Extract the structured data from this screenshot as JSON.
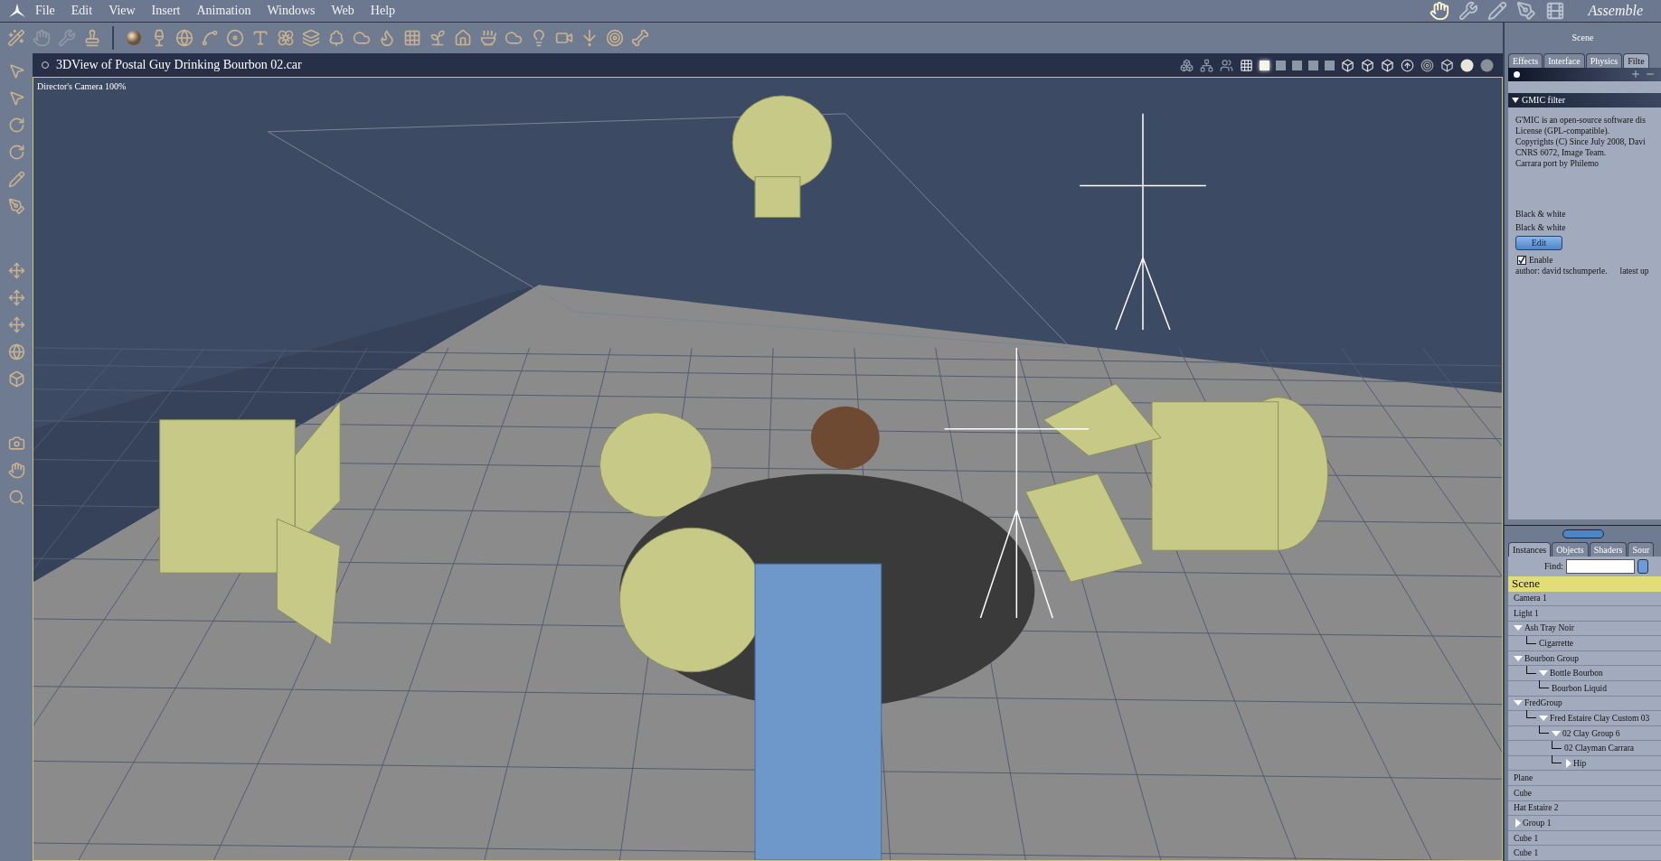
{
  "menu": [
    "File",
    "Edit",
    "View",
    "Insert",
    "Animation",
    "Windows",
    "Web",
    "Help"
  ],
  "rooms": {
    "label": "Assemble",
    "items": [
      {
        "selected": true
      },
      {
        "selected": false
      },
      {
        "selected": false
      },
      {
        "selected": false
      },
      {
        "selected": false
      }
    ]
  },
  "viewport": {
    "title": "3DView of Postal Guy Drinking Bourbon 02.car",
    "camera": "Director's Camera 100%",
    "layouts": [
      {
        "selected": true
      },
      {
        "selected": false
      },
      {
        "selected": false
      },
      {
        "selected": false
      },
      {
        "selected": false
      }
    ]
  },
  "properties": {
    "header": "Scene",
    "tabs": [
      {
        "label": "Effects",
        "selected": false
      },
      {
        "label": "Interface",
        "selected": false
      },
      {
        "label": "Physics",
        "selected": false
      },
      {
        "label": "Filte",
        "selected": true
      }
    ],
    "section": {
      "title": "GMIC filter",
      "expanded": true,
      "description": [
        "G'MIC is an open-source software dis",
        "License (GPL-compatible).",
        "Copyrights (C) Since July 2008, Davi",
        "CNRS 6072, Image Team.",
        "Carrara port by Philemo"
      ],
      "presets": [
        "Black & white",
        "Black & white"
      ],
      "edit_button": "Edit",
      "enable": {
        "label": "Enable",
        "checked": true
      },
      "author": "author: david tschumperle.",
      "latest": "latest up"
    }
  },
  "browser": {
    "tabs": [
      {
        "label": "Instances",
        "selected": true
      },
      {
        "label": "Objects",
        "selected": false
      },
      {
        "label": "Shaders",
        "selected": false
      },
      {
        "label": "Sour",
        "selected": false
      }
    ],
    "find_label": "Find:",
    "root": {
      "label": "Scene",
      "selected": true
    },
    "tree": [
      {
        "label": "Camera 1"
      },
      {
        "label": "Light 1"
      },
      {
        "label": "Ash Tray Noir",
        "expanded": true,
        "children": [
          {
            "label": "Cigarrette"
          }
        ]
      },
      {
        "label": "Bourbon Group",
        "expanded": true,
        "children": [
          {
            "label": "Bottle Bourbon",
            "expanded": true,
            "children": [
              {
                "label": "Bourbon Liquid"
              }
            ]
          }
        ]
      },
      {
        "label": "FredGroup",
        "expanded": true,
        "children": [
          {
            "label": "Fred Estaire Clay Custom 03",
            "expanded": true,
            "children": [
              {
                "label": "02 Clay Group 6",
                "expanded": true,
                "children": [
                  {
                    "label": "02 Clayman Carrara"
                  },
                  {
                    "label": "Hip",
                    "expanded": false
                  }
                ]
              }
            ]
          }
        ]
      },
      {
        "label": "Plane"
      },
      {
        "label": "Cube"
      },
      {
        "label": "Hat Estaire 2"
      },
      {
        "label": "Group 1",
        "expanded": false
      },
      {
        "label": "Cube 1"
      },
      {
        "label": "Cube 1"
      }
    ]
  }
}
